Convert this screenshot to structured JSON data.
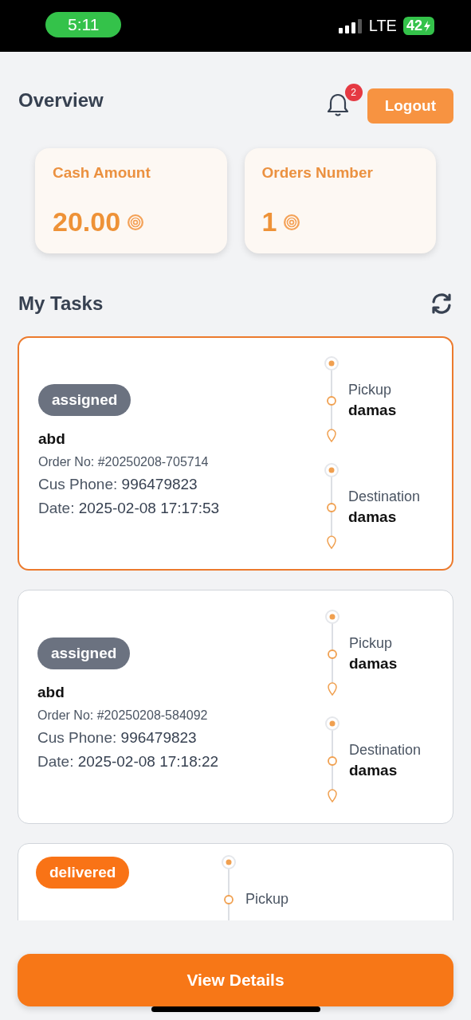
{
  "status_bar": {
    "time": "5:11",
    "network": "LTE",
    "battery": "42"
  },
  "header": {
    "title": "Overview",
    "notifications": "2",
    "logout": "Logout"
  },
  "stats": [
    {
      "label": "Cash Amount",
      "value": "20.00"
    },
    {
      "label": "Orders Number",
      "value": "1"
    }
  ],
  "tasks_title": "My Tasks",
  "tasks": [
    {
      "selected": true,
      "status": "assigned",
      "color": "#6b7280",
      "customer": "abd",
      "order_no": "Order No: #20250208-705714",
      "phone_label": "Cus Phone:",
      "phone": "996479823",
      "date_label": "Date:",
      "date": "2025-02-08 17:17:53",
      "stops": [
        {
          "label": "Pickup",
          "value": "damas"
        },
        {
          "label": "Destination",
          "value": "damas"
        }
      ]
    },
    {
      "selected": false,
      "status": "assigned",
      "color": "#6b7280",
      "customer": "abd",
      "order_no": "Order No: #20250208-584092",
      "phone_label": "Cus Phone:",
      "phone": "996479823",
      "date_label": "Date:",
      "date": "2025-02-08 17:18:22",
      "stops": [
        {
          "label": "Pickup",
          "value": "damas"
        },
        {
          "label": "Destination",
          "value": "damas"
        }
      ]
    },
    {
      "selected": false,
      "status": "delivered",
      "color": "#f97316",
      "stops": [
        {
          "label": "Pickup"
        }
      ]
    }
  ],
  "action": "View Details"
}
